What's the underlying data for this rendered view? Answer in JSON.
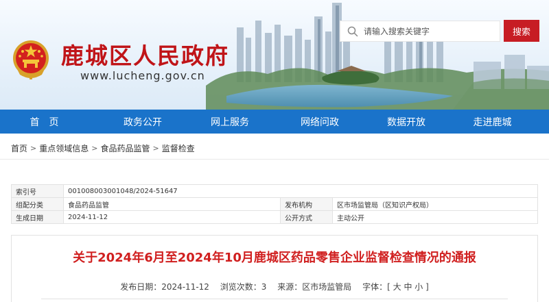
{
  "site": {
    "name": "鹿城区人民政府",
    "domain": "www.lucheng.gov.cn"
  },
  "search": {
    "placeholder": "请输入搜索关键字",
    "button_label": "搜索"
  },
  "nav": {
    "items": [
      "首　页",
      "政务公开",
      "网上服务",
      "网络问政",
      "数据开放",
      "走进鹿城"
    ]
  },
  "breadcrumb": [
    "首页",
    "重点领域信息",
    "食品药品监管",
    "监督检查"
  ],
  "meta": {
    "index_label": "索引号",
    "index_value": "001008003001048/2024-51647",
    "category_label": "组配分类",
    "category_value": "食品药品监管",
    "publisher_label": "发布机构",
    "publisher_value": "区市场监管局（区知识产权局）",
    "date_label": "生成日期",
    "date_value": "2024-11-12",
    "mode_label": "公开方式",
    "mode_value": "主动公开"
  },
  "article": {
    "title": "关于2024年6月至2024年10月鹿城区药品零售企业监督检查情况的通报",
    "publish_date": "发布日期：2024-11-12",
    "views": "浏览次数：3",
    "source": "来源：区市场监管局",
    "font_size_label": "字体：[",
    "font_size_large": "大",
    "font_size_medium": "中",
    "font_size_small": "小",
    "font_size_end": "]"
  },
  "colors": {
    "brand_red": "#c01418",
    "nav_blue": "#1a73ca",
    "search_button": "#c71d24",
    "title_red": "#d01f1f"
  },
  "icons": {
    "emblem": "national-emblem-icon",
    "search": "search-icon",
    "breadcrumb_separator": "chevron-right-icon"
  }
}
